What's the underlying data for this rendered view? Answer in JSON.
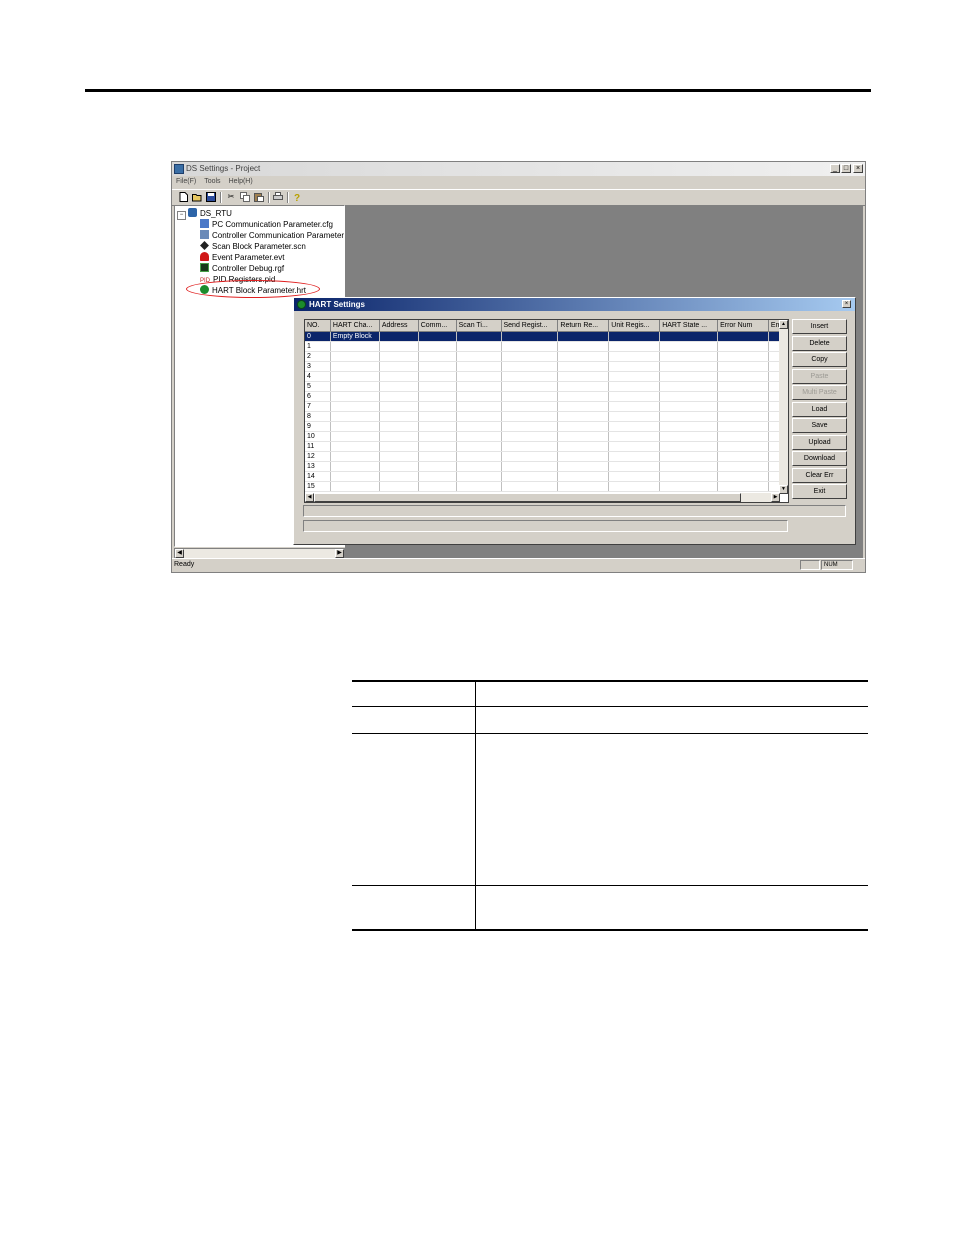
{
  "window": {
    "title": "DS Settings - Project",
    "menu": [
      "File(F)",
      "Tools",
      "Help(H)"
    ],
    "controls": {
      "minimize": "_",
      "maximize": "□",
      "close": "×"
    },
    "status": {
      "text": "Ready",
      "num": "NUM"
    }
  },
  "toolbar": {
    "icons": [
      "new-icon",
      "open-icon",
      "save-icon",
      "cut-icon",
      "copy-icon",
      "paste-icon",
      "print-icon",
      "help-icon"
    ]
  },
  "tree": {
    "root": "DS_RTU",
    "items": [
      {
        "label": "PC Communication Parameter.cfg",
        "icon": "pc-comm-icon"
      },
      {
        "label": "Controller Communication Parameter",
        "icon": "controller-comm-icon"
      },
      {
        "label": "Scan Block Parameter.scn",
        "icon": "scan-block-icon"
      },
      {
        "label": "Event Parameter.evt",
        "icon": "event-icon"
      },
      {
        "label": "Controller Debug.rgf",
        "icon": "debug-icon"
      },
      {
        "label": "PID Registers.pid",
        "icon": "pid-icon",
        "prefix": "PID"
      },
      {
        "label": "HART Block Parameter.hrt",
        "icon": "hart-icon"
      }
    ]
  },
  "dialog": {
    "title": "HART Settings",
    "close": "×",
    "columns": [
      "NO.",
      "HART Cha...",
      "Address",
      "Comm...",
      "Scan Ti...",
      "Send Regist...",
      "Return Re...",
      "Unit Regis...",
      "HART State ...",
      "Error Num",
      "Erro"
    ],
    "rows": [
      [
        "0",
        "Empty Block"
      ],
      [
        "1",
        ""
      ],
      [
        "2",
        ""
      ],
      [
        "3",
        ""
      ],
      [
        "4",
        ""
      ],
      [
        "5",
        ""
      ],
      [
        "6",
        ""
      ],
      [
        "7",
        ""
      ],
      [
        "8",
        ""
      ],
      [
        "9",
        ""
      ],
      [
        "10",
        ""
      ],
      [
        "11",
        ""
      ],
      [
        "12",
        ""
      ],
      [
        "13",
        ""
      ],
      [
        "14",
        ""
      ],
      [
        "15",
        ""
      ]
    ],
    "buttons": [
      {
        "label": "Insert",
        "enabled": true
      },
      {
        "label": "Delete",
        "enabled": true
      },
      {
        "label": "Copy",
        "enabled": true
      },
      {
        "label": "Paste",
        "enabled": false
      },
      {
        "label": "Multi Paste",
        "enabled": false
      },
      {
        "label": "Load",
        "enabled": true
      },
      {
        "label": "Save",
        "enabled": true
      },
      {
        "label": "Upload",
        "enabled": true
      },
      {
        "label": "Download",
        "enabled": true
      },
      {
        "label": "Clear Err",
        "enabled": true
      },
      {
        "label": "Exit",
        "enabled": true
      }
    ]
  },
  "colors": {
    "selection": "#0a246a",
    "highlight_ellipse": "#e02020",
    "dialog_title": "#0a246a"
  }
}
